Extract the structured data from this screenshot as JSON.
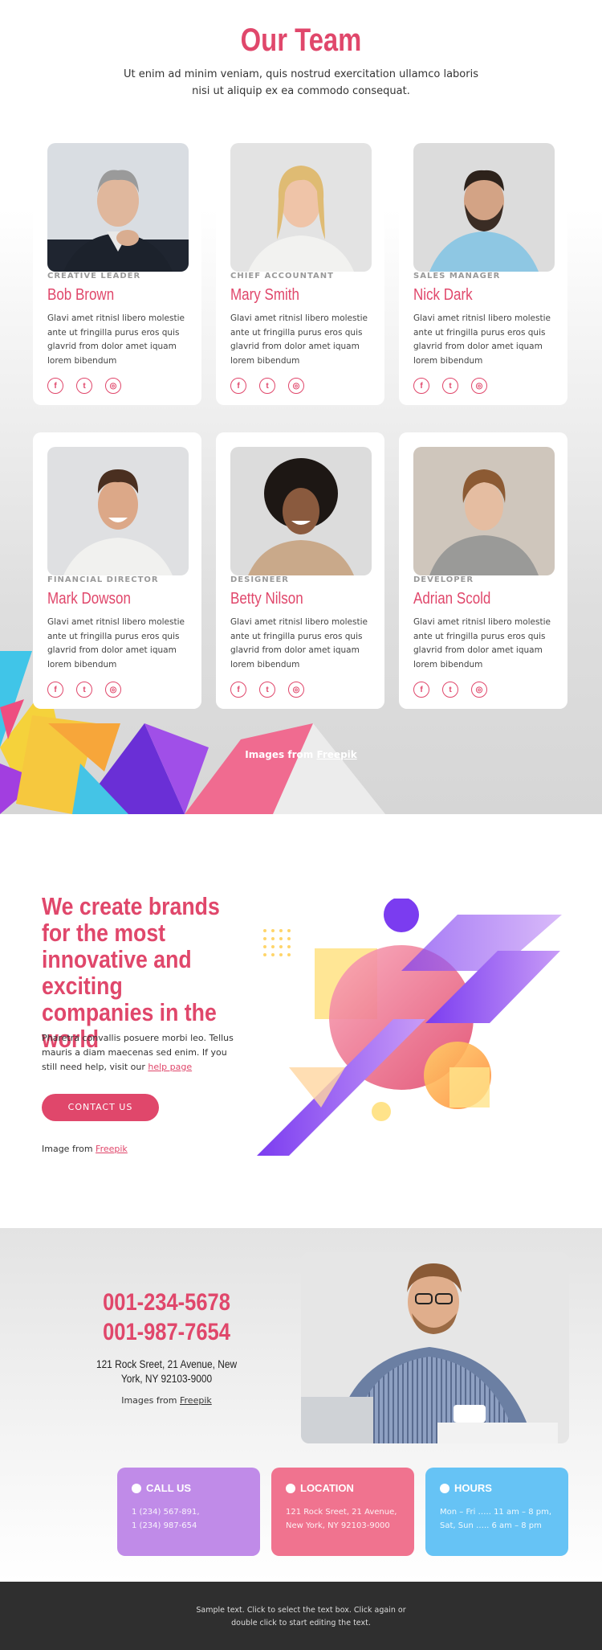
{
  "team": {
    "title": "Our Team",
    "subtitle": "Ut enim ad minim veniam, quis nostrud exercitation ullamco laboris nisi ut aliquip ex ea commodo consequat.",
    "credit_prefix": "Images from",
    "credit_link": "Freepik",
    "members": [
      {
        "role": "CREATIVE LEADER",
        "name": "Bob Brown",
        "desc": "Glavi amet ritnisl libero molestie ante ut fringilla purus eros quis glavrid from dolor amet iquam lorem bibendum"
      },
      {
        "role": "CHIEF ACCOUNTANT",
        "name": "Mary Smith",
        "desc": "Glavi amet ritnisl libero molestie ante ut fringilla purus eros quis glavrid from dolor amet iquam lorem bibendum"
      },
      {
        "role": "SALES MANAGER",
        "name": "Nick Dark",
        "desc": "Glavi amet ritnisl libero molestie ante ut fringilla purus eros quis glavrid from dolor amet iquam lorem bibendum"
      },
      {
        "role": "FINANCIAL DIRECTOR",
        "name": "Mark Dowson",
        "desc": "Glavi amet ritnisl libero molestie ante ut fringilla purus eros quis glavrid from dolor amet iquam lorem bibendum"
      },
      {
        "role": "DESIGNEER",
        "name": "Betty Nilson",
        "desc": "Glavi amet ritnisl libero molestie ante ut fringilla purus eros quis glavrid from dolor amet iquam lorem bibendum"
      },
      {
        "role": "DEVELOPER",
        "name": "Adrian Scold",
        "desc": "Glavi amet ritnisl libero molestie ante ut fringilla purus eros quis glavrid from dolor amet iquam lorem bibendum"
      }
    ],
    "social_icons": [
      "facebook-icon",
      "twitter-icon",
      "instagram-icon"
    ]
  },
  "brands": {
    "heading": "We create brands for the most innovative and exciting companies in the world",
    "text": "Pharetra convallis posuere morbi leo. Tellus mauris a diam maecenas sed enim. If you still need help, visit our",
    "text_link": "help page",
    "button": "CONTACT US",
    "credit_prefix": "Image from",
    "credit_link": "Freepik"
  },
  "contact": {
    "phone1": "001-234-5678",
    "phone2": "001-987-7654",
    "address1": "121 Rock Sreet, 21 Avenue, New",
    "address2": "York, NY 92103-9000",
    "credit_prefix": "Images from",
    "credit_link": "Freepik",
    "boxes": [
      {
        "title": "CALL US",
        "line1": "1 (234) 567-891,",
        "line2": "1 (234) 987-654",
        "color": "#c08be8"
      },
      {
        "title": "LOCATION",
        "line1": "121 Rock Sreet, 21 Avenue,",
        "line2": "New York, NY 92103-9000",
        "color": "#f0738f"
      },
      {
        "title": "HOURS",
        "line1": "Mon – Fri ….. 11 am – 8 pm,",
        "line2": "Sat, Sun ….. 6 am – 8 pm",
        "color": "#66c3f5"
      }
    ]
  },
  "footer": {
    "line1": "Sample text. Click to select the text box. Click again or",
    "line2": "double click to start editing the text."
  },
  "colors": {
    "accent": "#e0476b",
    "dark": "#2f2f2f"
  }
}
